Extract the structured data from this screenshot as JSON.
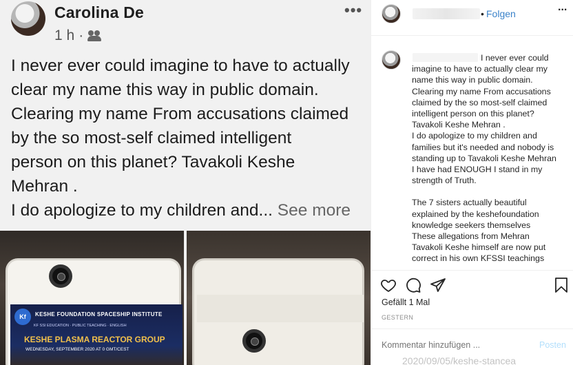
{
  "media": {
    "fb_post": {
      "author": "Carolina De",
      "time": "1 h",
      "separator": "·",
      "more_menu": "•••",
      "text_lines": [
        "I never ever could imagine to have to actually",
        "clear my name this way in public domain.",
        "Clearing my name From accusations claimed",
        "by the so most-self claimed intelligent",
        "person on this planet? Tavakoli Keshe",
        "Mehran ."
      ],
      "last_line": "I do apologize to my children and...",
      "see_more": "See more"
    },
    "photo_screen": {
      "logo": "Kf",
      "title": "KESHE FOUNDATION SPACESHIP INSTITUTE",
      "subtitle": "KF SSI EDUCATION · PUBLIC TEACHING · ENGLISH",
      "group": "KESHE PLASMA REACTOR GROUP",
      "date": "WEDNESDAY, SEPTEMBER 2020 AT 0 GMT/CEST"
    }
  },
  "panel": {
    "header": {
      "follow_label": "Folgen",
      "dot": "•",
      "more_label": "..."
    },
    "caption": [
      "I never ever could imagine to have to actually clear my name this way in public domain. Clearing my name From accusations claimed by the so most-self claimed intelligent person on this planet? Tavakoli Keshe Mehran .",
      "I do apologize to my children and families but it's needed and nobody is standing up to Tavakoli Keshe Mehran",
      "I have had ENOUGH I stand in my strength of Truth.",
      "",
      "The 7 sisters actually beautiful explained by the keshefoundation knowledge seekers themselves",
      "These allegations from Mehran Tavakoli Keshe himself are now put correct in his own KFSSI teachings"
    ],
    "likes": "Gefällt 1 Mal",
    "date": "GESTERN",
    "comment": {
      "placeholder": "Kommentar hinzufügen ...",
      "post_label": "Posten"
    },
    "under_text": "2020/09/05/keshe-stancea",
    "icons": [
      "heart-icon",
      "comment-icon",
      "share-icon",
      "bookmark-icon"
    ],
    "colors": {
      "follow": "#3a82c9",
      "post_disabled": "#b2dffc",
      "muted": "#8e8e8e"
    }
  }
}
